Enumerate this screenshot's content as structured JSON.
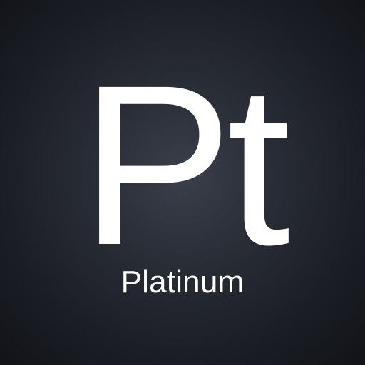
{
  "element": {
    "symbol": "Pt",
    "name": "Platinum"
  },
  "colors": {
    "text": "#ffffff",
    "background_center": "#3a3f4b",
    "background_edge": "#111318"
  }
}
